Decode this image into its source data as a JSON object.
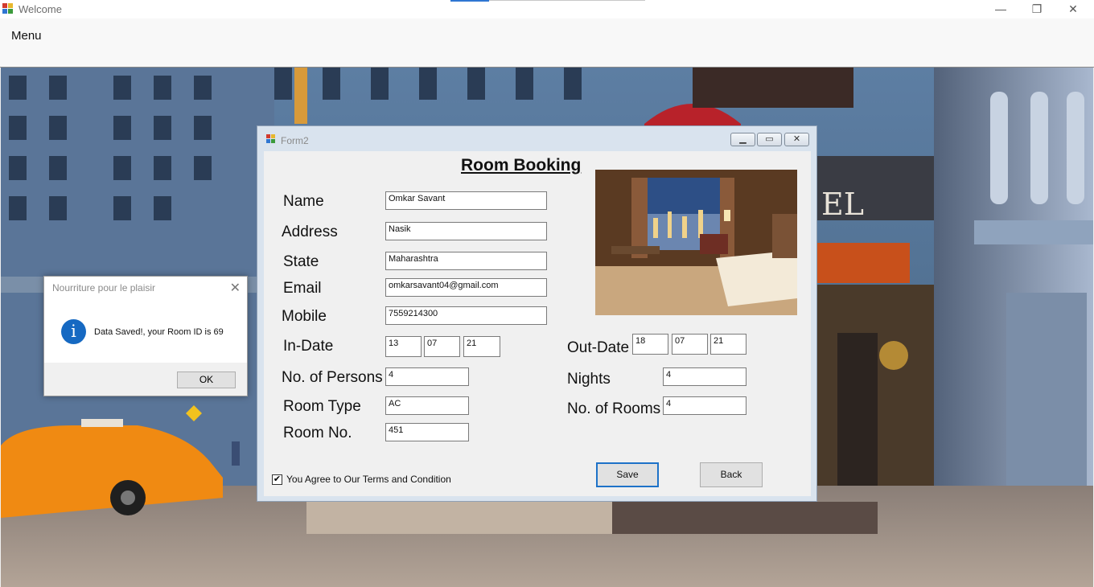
{
  "window": {
    "title": "Welcome",
    "menu_label": "Menu",
    "minimize": "—",
    "restore": "❐",
    "close": "✕"
  },
  "form": {
    "title": "Form2",
    "heading": "Room Booking",
    "labels": {
      "name": "Name",
      "address": "Address",
      "state": "State",
      "email": "Email",
      "mobile": "Mobile",
      "in_date": "In-Date",
      "out_date": "Out-Date",
      "persons": "No. of Persons",
      "nights": "Nights",
      "room_type": "Room Type",
      "rooms": "No. of Rooms",
      "room_no": "Room No."
    },
    "values": {
      "name": "Omkar Savant",
      "address": "Nasik",
      "state": "Maharashtra",
      "email": "omkarsavant04@gmail.com",
      "mobile": "7559214300",
      "in_day": "13",
      "in_month": "07",
      "in_year": "21",
      "out_day": "18",
      "out_month": "07",
      "out_year": "21",
      "persons": "4",
      "nights": "4",
      "room_type": "AC",
      "rooms": "4",
      "room_no": "451"
    },
    "terms_label": "You Agree to Our Terms and Condition",
    "terms_checked": true,
    "save_label": "Save",
    "back_label": "Back"
  },
  "message_box": {
    "title": "Nourriture pour le plaisir",
    "text": "Data Saved!, your Room ID is 69",
    "ok_label": "OK",
    "icon": "info-icon"
  },
  "colors": {
    "accent": "#1e72c8",
    "info_icon": "#1669c2"
  }
}
